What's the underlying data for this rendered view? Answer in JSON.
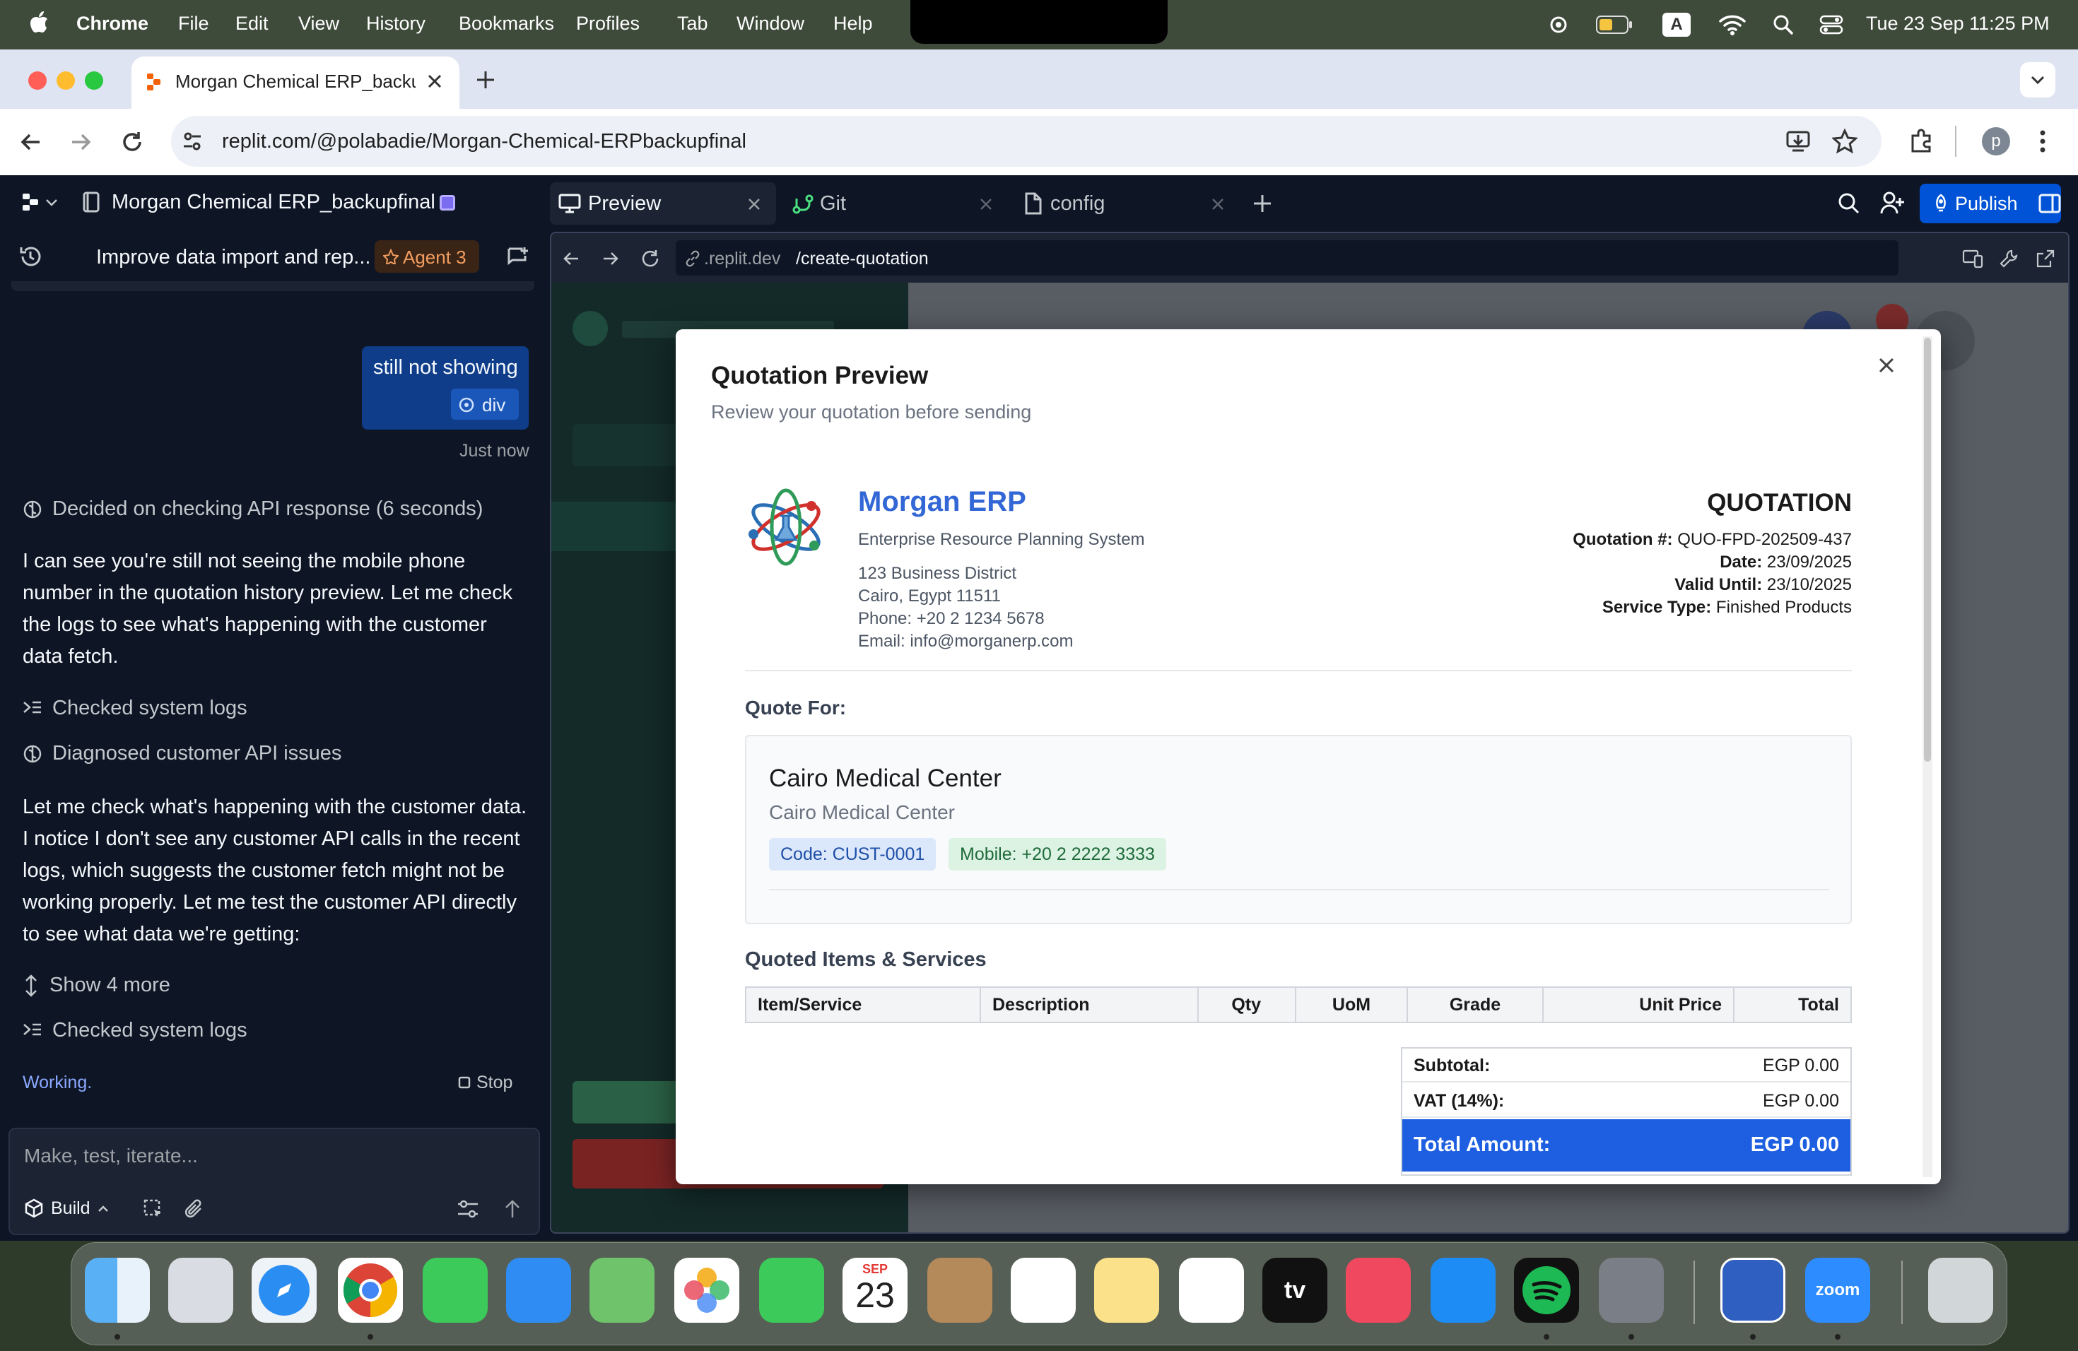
{
  "menubar": {
    "app": "Chrome",
    "items": [
      "File",
      "Edit",
      "View",
      "History",
      "Bookmarks",
      "Profiles",
      "Tab",
      "Window",
      "Help"
    ],
    "datetime": "Tue 23 Sep  11:25 PM",
    "input_indicator": "A"
  },
  "browser": {
    "tab_title": "Morgan Chemical ERP_backu",
    "url": "replit.com/@polabadie/Morgan-Chemical-ERPbackupfinal",
    "profile_initial": "p"
  },
  "replit": {
    "project_name": "Morgan Chemical ERP_backupfinal",
    "tabs": [
      "Preview",
      "Git",
      "config"
    ],
    "publish_label": "Publish",
    "agent": {
      "thread_title": "Improve data import and rep...",
      "agent_badge": "Agent 3",
      "user_message": "still not showing",
      "user_chip": "div",
      "timestamp": "Just now",
      "decided": "Decided on checking API response (6 seconds)",
      "msg1": "I can see you're still not seeing the mobile phone number in the quotation history preview. Let me check the logs to see what's happening with the customer data fetch.",
      "step1": "Checked system logs",
      "step2": "Diagnosed customer API issues",
      "msg2": "Let me check what's happening with the customer data. I notice I don't see any customer API calls in the recent logs, which suggests the customer fetch might not be working properly. Let me test the customer API directly to see what data we're getting:",
      "show_more": "Show 4 more",
      "step3": "Checked system logs",
      "status": "Working.",
      "stop": "Stop",
      "input_placeholder": "Make, test, iterate...",
      "build_label": "Build"
    },
    "preview": {
      "url_host": ".replit.dev",
      "url_path": "/create-quotation"
    }
  },
  "modal": {
    "title": "Quotation Preview",
    "subtitle": "Review your quotation before sending",
    "company": {
      "name": "Morgan ERP",
      "tagline": "Enterprise Resource Planning System",
      "address1": "123 Business District",
      "address2": "Cairo, Egypt 11511",
      "phone": "Phone: +20 2 1234 5678",
      "email": "Email: info@morganerp.com"
    },
    "doc": {
      "type": "QUOTATION",
      "number_label": "Quotation #:",
      "number": "QUO-FPD-202509-437",
      "date_label": "Date:",
      "date": "23/09/2025",
      "valid_label": "Valid Until:",
      "valid": "23/10/2025",
      "service_label": "Service Type:",
      "service": "Finished Products"
    },
    "quote_for_label": "Quote For:",
    "customer": {
      "name": "Cairo Medical Center",
      "subname": "Cairo Medical Center",
      "code": "Code: CUST-0001",
      "mobile": "Mobile: +20 2 2222 3333"
    },
    "items_title": "Quoted Items & Services",
    "columns": [
      "Item/Service",
      "Description",
      "Qty",
      "UoM",
      "Grade",
      "Unit Price",
      "Total"
    ],
    "totals": {
      "subtotal_label": "Subtotal:",
      "subtotal": "EGP 0.00",
      "vat_label": "VAT (14%):",
      "vat": "EGP 0.00",
      "total_label": "Total Amount:",
      "total": "EGP 0.00"
    }
  },
  "dock": {
    "calendar_month": "SEP",
    "calendar_day": "23",
    "tv_label": "tv",
    "zoom_label": "zoom"
  },
  "colors": {
    "replit_bg": "#0e1525",
    "publish": "#0053d6",
    "user_bubble": "#0f3d8a",
    "erp_blue": "#3367d6",
    "total_bar": "#1d5fe0"
  }
}
